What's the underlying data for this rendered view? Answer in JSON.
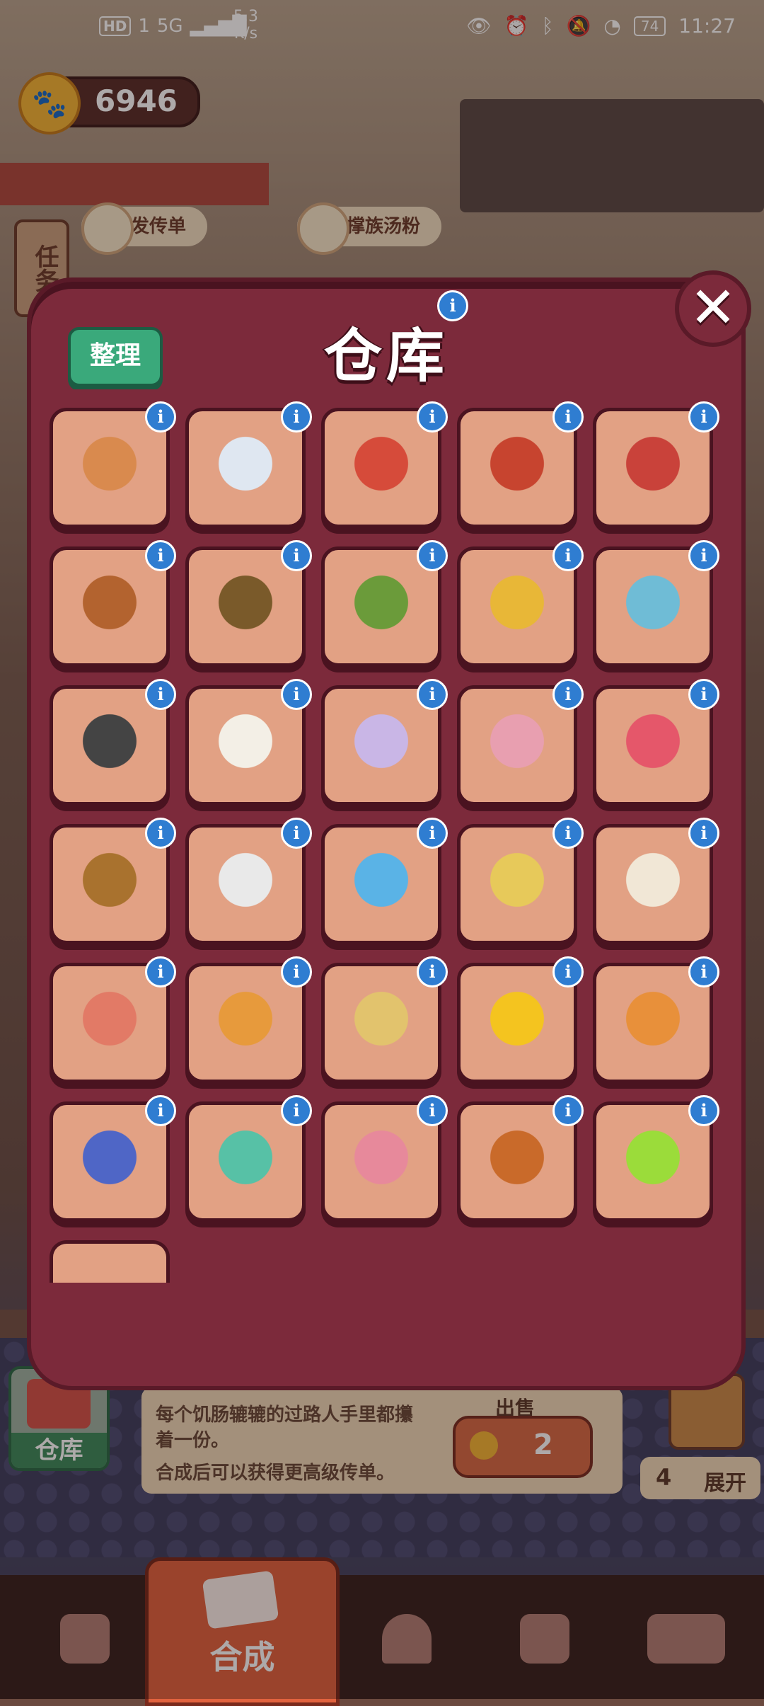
{
  "status_bar": {
    "hd_label": "HD",
    "sim": "1",
    "net_type": "5G",
    "net_speed": "5.3",
    "net_unit": "K/s",
    "battery": "74",
    "time": "11:27"
  },
  "coins": {
    "value": "6946"
  },
  "background_tasks": {
    "task_tag": "任务",
    "chips": [
      "发传单",
      "撑族汤粉"
    ]
  },
  "warehouse_modal": {
    "title": "仓库",
    "sort_label": "整理",
    "close_label": "✕",
    "info_label": "i",
    "items": [
      {
        "name": "clay-pot-soup",
        "color": "#d98a4e"
      },
      {
        "name": "paper-flyers",
        "color": "#dfe7f1"
      },
      {
        "name": "mala-sauce-jar",
        "color": "#d64b3a"
      },
      {
        "name": "chili-oil-bottle",
        "color": "#c7442f"
      },
      {
        "name": "pickled-chili-jar",
        "color": "#c9423a"
      },
      {
        "name": "soy-sauce-bottle",
        "color": "#b3632f"
      },
      {
        "name": "fish-sauce-jar",
        "color": "#7a5a2a"
      },
      {
        "name": "herb-tray",
        "color": "#6b9b3a"
      },
      {
        "name": "gold-medal",
        "color": "#e8b737"
      },
      {
        "name": "chocolate-box",
        "color": "#6fbcd6"
      },
      {
        "name": "camera",
        "color": "#444444"
      },
      {
        "name": "sheep-plush",
        "color": "#f3efe6"
      },
      {
        "name": "wind-chime",
        "color": "#c9b6e6"
      },
      {
        "name": "music-box",
        "color": "#e89fb0"
      },
      {
        "name": "rose-bouquet",
        "color": "#e5576a"
      },
      {
        "name": "dreamcatcher",
        "color": "#a9722e"
      },
      {
        "name": "work-gloves",
        "color": "#e9e9e9"
      },
      {
        "name": "dolphin-plush",
        "color": "#5ab3e6"
      },
      {
        "name": "parfait-drink",
        "color": "#e7c95a"
      },
      {
        "name": "tea-banner",
        "color": "#f1e7d6"
      },
      {
        "name": "gift-basket",
        "color": "#e27a66"
      },
      {
        "name": "pizza",
        "color": "#e79a3c"
      },
      {
        "name": "soup-bowl",
        "color": "#e2c36d"
      },
      {
        "name": "sun",
        "color": "#f4c41f"
      },
      {
        "name": "orange-ball",
        "color": "#e8903a"
      },
      {
        "name": "drum",
        "color": "#4f66c6"
      },
      {
        "name": "jade-jar",
        "color": "#57c1a6"
      },
      {
        "name": "mop",
        "color": "#e7899b"
      },
      {
        "name": "wooden-barrel",
        "color": "#c96a2a"
      },
      {
        "name": "cocktail",
        "color": "#9bdc3a"
      }
    ],
    "partial_slots": 1
  },
  "bottom_panel": {
    "warehouse_tab": "仓库",
    "desc_line1": "每个饥肠辘辘的过路人手里都攥",
    "desc_line2": "着一份。",
    "desc_line3": "合成后可以获得更高级传单。",
    "sell_label": "出售",
    "sell_value": "2",
    "expand_count": "4",
    "expand_label": "展开"
  },
  "nav": {
    "center_label": "合成"
  }
}
